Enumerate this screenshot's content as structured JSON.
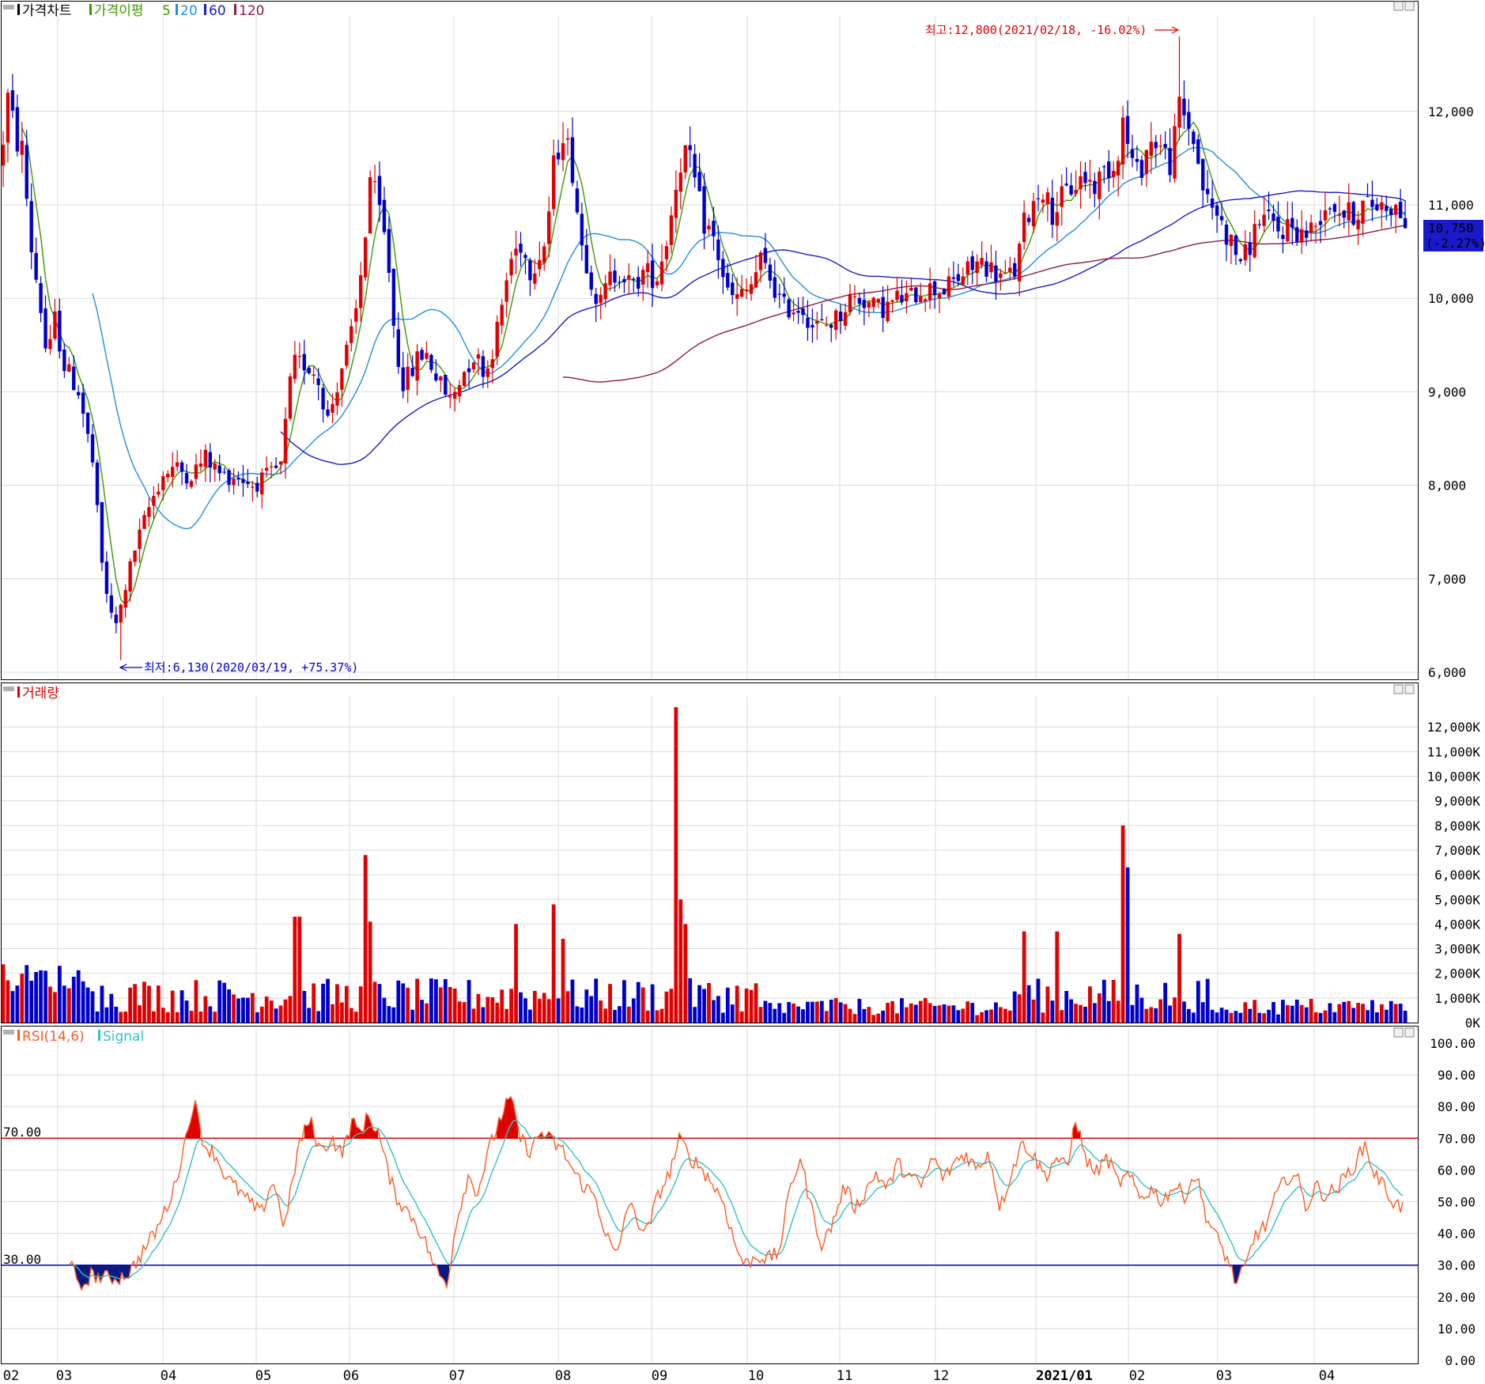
{
  "colors": {
    "up": "#e00000",
    "down": "#0000cc",
    "ma5": "#3a9a00",
    "ma20": "#1e8fe0",
    "ma60": "#1a1ac8",
    "ma120": "#8b1a4a",
    "rsi": "#ff5a1e",
    "signal": "#33c0c8",
    "grid": "#d9d9d9",
    "ref70": "#e00000",
    "ref30": "#0000cc"
  },
  "price_panel": {
    "legend": {
      "title": "가격차트",
      "ma_label": "가격이평",
      "ma5": "5",
      "ma20": "20",
      "ma60": "60",
      "ma120": "120"
    },
    "high_annotation": "최고:12,800(2021/02/18, -16.02%)",
    "low_annotation": "최저:6,130(2020/03/19, +75.37%)",
    "current_price": "10,750",
    "current_change": "(-2.27%)",
    "y_ticks": [
      "6,000",
      "7,000",
      "8,000",
      "9,000",
      "10,000",
      "11,000",
      "12,000"
    ]
  },
  "volume_panel": {
    "legend": {
      "title": "거래량"
    },
    "y_ticks": [
      "0K",
      "1,000K",
      "2,000K",
      "3,000K",
      "4,000K",
      "5,000K",
      "6,000K",
      "7,000K",
      "8,000K",
      "9,000K",
      "10,000K",
      "11,000K",
      "12,000K"
    ]
  },
  "rsi_panel": {
    "legend": {
      "rsi": "RSI(14,6)",
      "signal": "Signal"
    },
    "level_high": "70.00",
    "level_low": "30.00",
    "y_ticks": [
      "0.00",
      "10.00",
      "20.00",
      "30.00",
      "40.00",
      "50.00",
      "60.00",
      "70.00",
      "80.00",
      "90.00",
      "100.00"
    ]
  },
  "x_axis": {
    "months": [
      "02",
      "03",
      "04",
      "05",
      "06",
      "07",
      "08",
      "09",
      "10",
      "11",
      "12",
      "2021/01",
      "02",
      "03",
      "04"
    ]
  },
  "chart_data": {
    "type": "candlestick",
    "price_ylim": [
      6000,
      12800
    ],
    "volume_ylim_k": [
      0,
      12800
    ],
    "rsi_ylim": [
      0,
      100
    ],
    "price_anchors": [
      {
        "month": "2020/02",
        "approx_close": 11800
      },
      {
        "month": "2020/03",
        "approx_close": 7200
      },
      {
        "date": "2020/03/19",
        "low": 6130
      },
      {
        "month": "2020/04",
        "approx_close": 8200
      },
      {
        "month": "2020/05",
        "approx_close": 8000
      },
      {
        "month": "2020/06",
        "approx_close": 10200
      },
      {
        "month": "2020/07",
        "approx_close": 8900
      },
      {
        "month": "2020/08",
        "approx_close": 11500
      },
      {
        "month": "2020/09",
        "approx_close": 11600
      },
      {
        "month": "2020/10",
        "approx_close": 10200
      },
      {
        "month": "2020/11",
        "approx_close": 9700
      },
      {
        "month": "2020/12",
        "approx_close": 10000
      },
      {
        "month": "2021/01",
        "approx_close": 11000
      },
      {
        "date": "2021/02/18",
        "high": 12800
      },
      {
        "month": "2021/03",
        "approx_close": 10300
      },
      {
        "month": "2021/04",
        "approx_close": 11000
      },
      {
        "date": "last",
        "close": 10750,
        "change_pct": -2.27
      }
    ],
    "volume_peaks_k": [
      {
        "month": "2020/05",
        "approx": 4300
      },
      {
        "month": "2020/06",
        "approx": 7800
      },
      {
        "month": "2020/07",
        "approx": 4000
      },
      {
        "month": "2020/08",
        "approx": 4800
      },
      {
        "month": "2020/09",
        "approx": 12800
      },
      {
        "month": "2021/01",
        "approx": 3700
      },
      {
        "month": "2021/02",
        "approx": 8000
      }
    ],
    "rsi_levels": [
      70,
      30
    ]
  }
}
